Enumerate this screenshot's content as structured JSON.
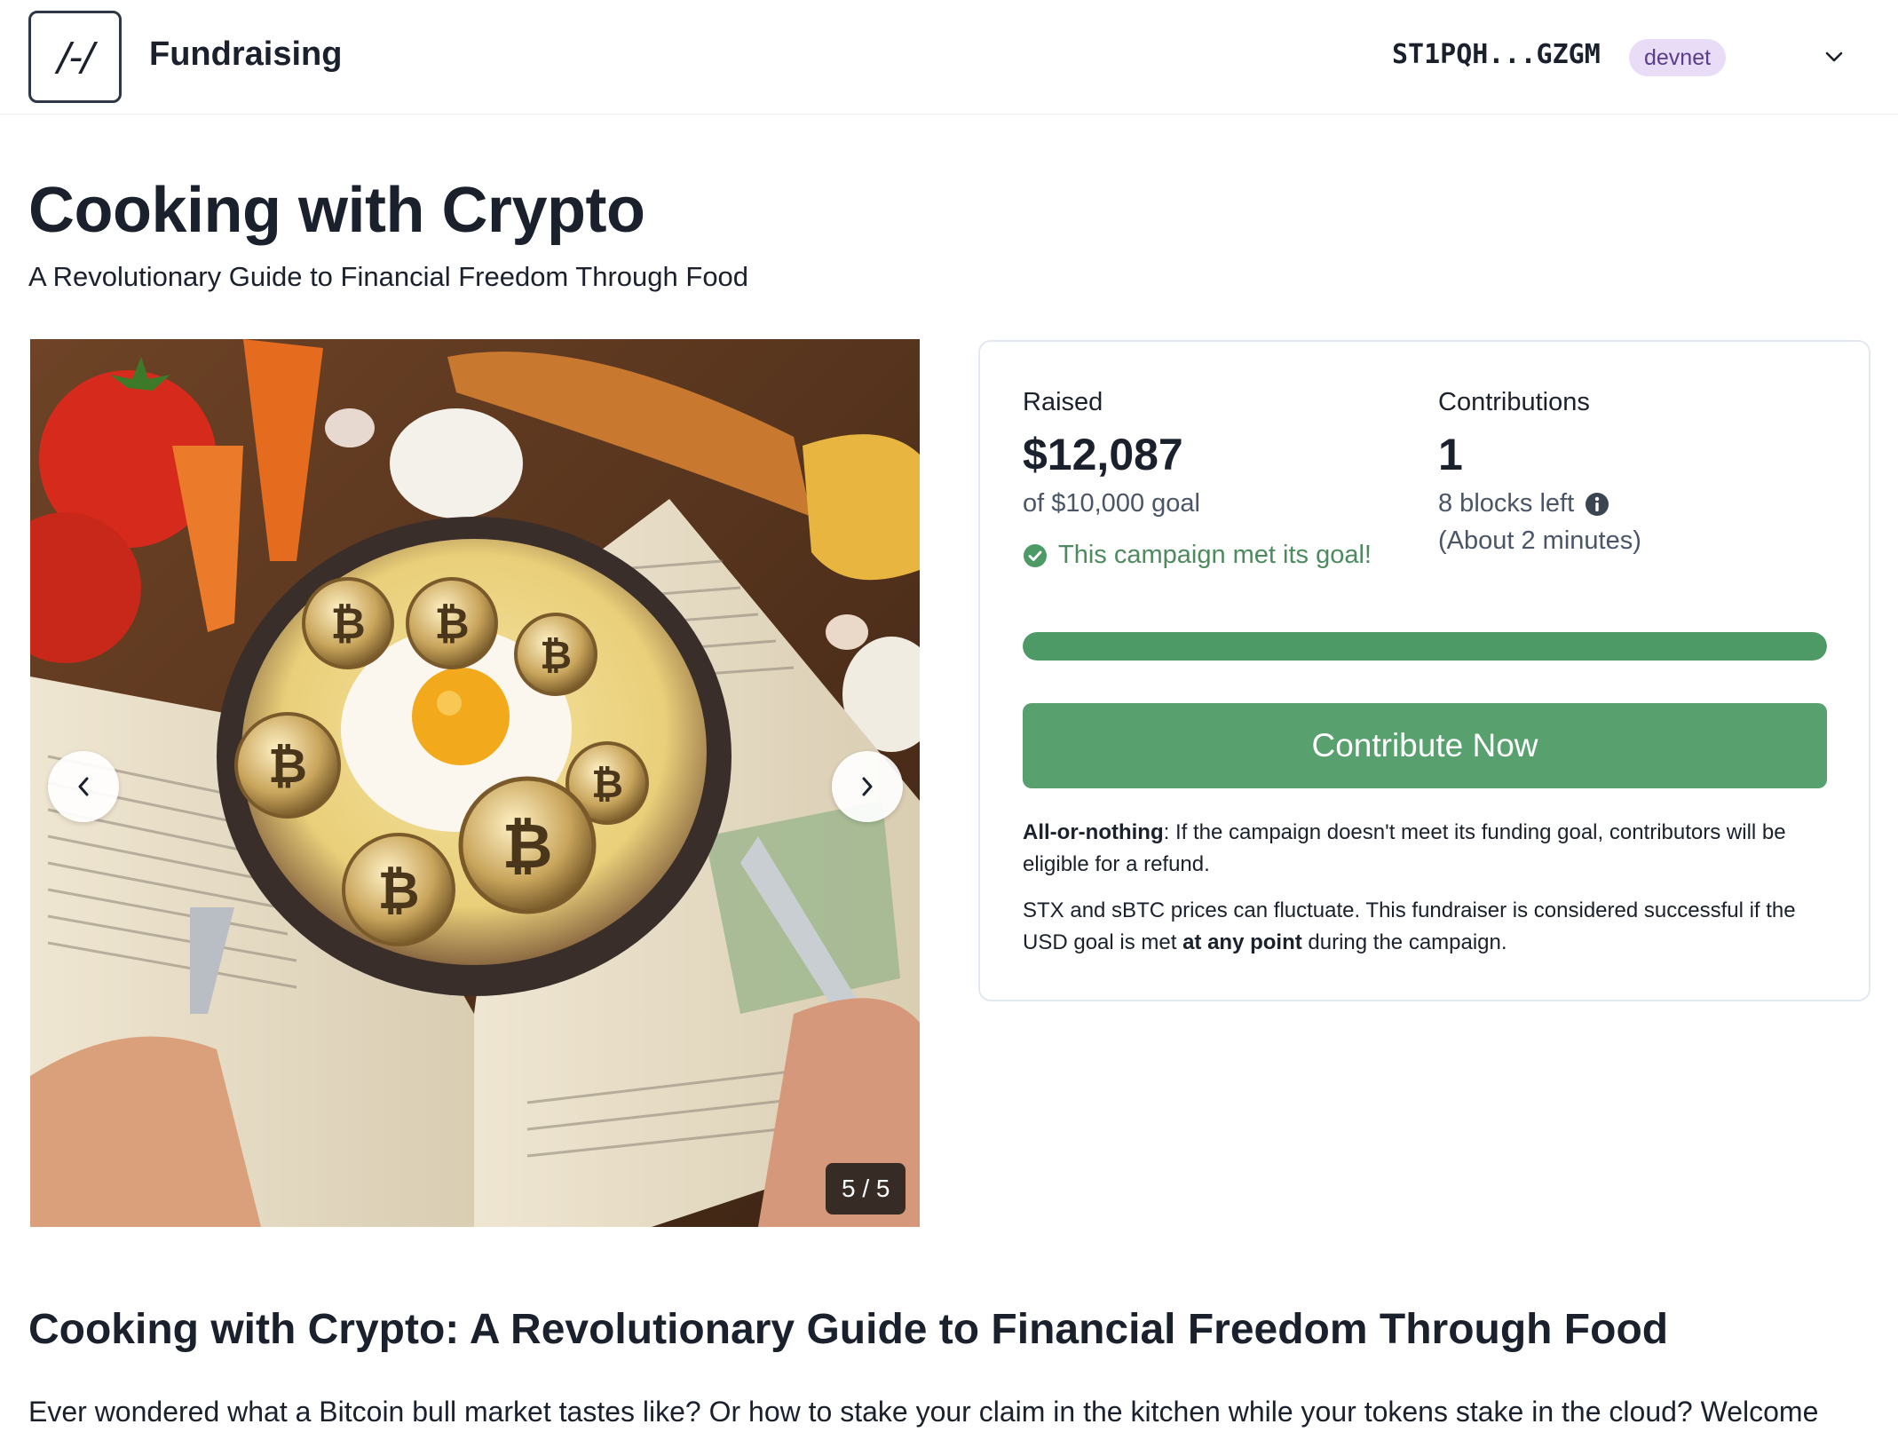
{
  "header": {
    "logo_text": "/-/",
    "brand": "Fundraising",
    "address": "ST1PQH...GZGM",
    "network": "devnet"
  },
  "campaign": {
    "title": "Cooking with Crypto",
    "subtitle": "A Revolutionary Guide to Financial Freedom Through Food"
  },
  "carousel": {
    "counter": "5 / 5",
    "coin_symbol": "₿"
  },
  "stats": {
    "raised_label": "Raised",
    "raised_value": "$12,087",
    "goal_text": "of $10,000 goal",
    "goal_met_text": "This campaign met its goal!",
    "contributions_label": "Contributions",
    "contributions_value": "1",
    "blocks_left": "8 blocks left",
    "time_left": "(About 2 minutes)",
    "progress_fraction": 1.0,
    "cta_label": "Contribute Now"
  },
  "notes": {
    "all_or_nothing_label": "All-or-nothing",
    "all_or_nothing_text": ": If the campaign doesn't meet its funding goal, contributors will be eligible for a refund.",
    "fluctuate_text_1": "STX and sBTC prices can fluctuate. This fundraiser is considered successful if the USD goal is met ",
    "fluctuate_bold": "at any point",
    "fluctuate_text_2": " during the campaign."
  },
  "description": {
    "heading": "Cooking with Crypto: A Revolutionary Guide to Financial Freedom Through Food",
    "body": "Ever wondered what a Bitcoin bull market tastes like? Or how to stake your claim in the kitchen while your tokens stake in the cloud? Welcome"
  },
  "colors": {
    "accent_green": "#58a06e",
    "success_text": "#4d8a5e",
    "badge_bg": "#e9dcf7"
  },
  "icons": [
    "chevron-down-icon",
    "chevron-left-icon",
    "chevron-right-icon",
    "check-circle-icon",
    "info-icon"
  ]
}
